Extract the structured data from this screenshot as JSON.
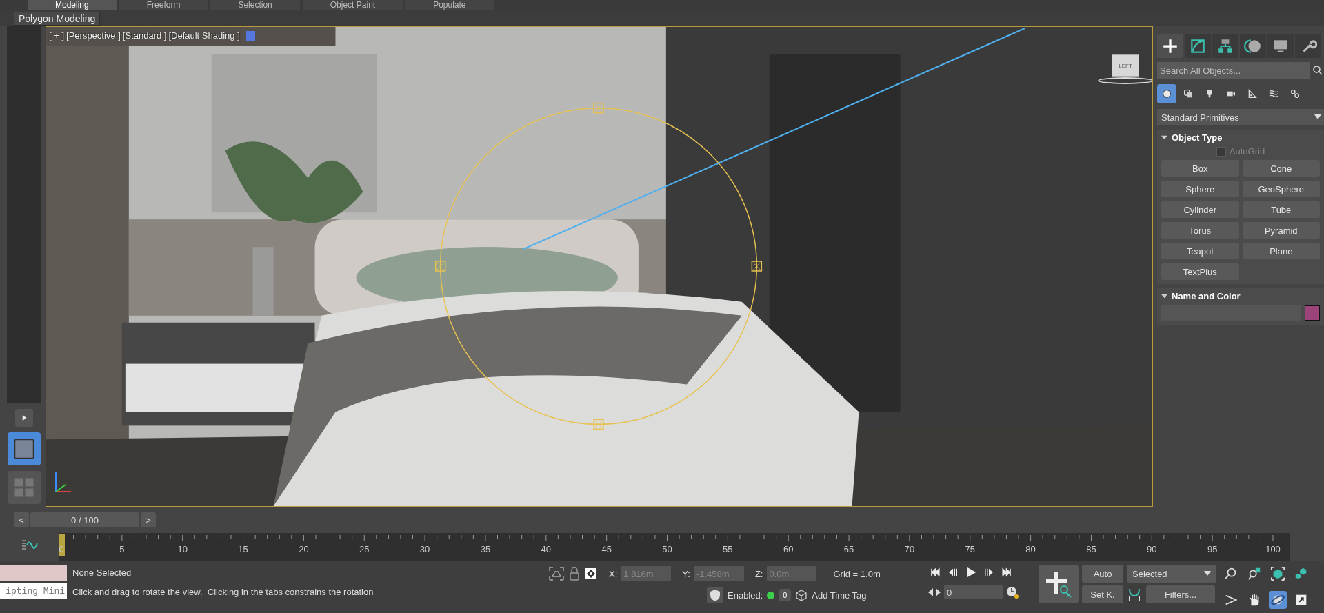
{
  "ribbon_tabs": [
    {
      "label": "Modeling",
      "selected": true
    },
    {
      "label": "Freeform",
      "selected": false
    },
    {
      "label": "Selection",
      "selected": false
    },
    {
      "label": "Object Paint",
      "selected": false
    },
    {
      "label": "Populate",
      "selected": false
    }
  ],
  "ribbon_panel": {
    "label": "Polygon Modeling"
  },
  "layouts": [
    {
      "kind": "single",
      "selected": true
    },
    {
      "kind": "quad",
      "selected": false
    }
  ],
  "viewport": {
    "labels": [
      "[ + ]",
      "[Perspective ]",
      "[Standard ]",
      "[Default Shading ]"
    ],
    "viewcube": "LEFT"
  },
  "command_panel": {
    "tabs": [
      {
        "kind": "create",
        "selected": true
      },
      {
        "kind": "modify",
        "selected": false
      },
      {
        "kind": "hierarchy",
        "selected": false
      },
      {
        "kind": "motion",
        "selected": false
      },
      {
        "kind": "display",
        "selected": false
      },
      {
        "kind": "utilities",
        "selected": false
      }
    ],
    "search": {
      "placeholder": "Search All Objects..."
    },
    "categories": [
      {
        "kind": "geometry",
        "selected": true
      },
      {
        "kind": "shapes",
        "selected": false
      },
      {
        "kind": "lights",
        "selected": false
      },
      {
        "kind": "cameras",
        "selected": false
      },
      {
        "kind": "helpers",
        "selected": false
      },
      {
        "kind": "spacewarps",
        "selected": false
      },
      {
        "kind": "systems",
        "selected": false
      }
    ],
    "dropdown": "Standard Primitives",
    "rollouts": [
      {
        "kind": "object_type",
        "title": "Object Type",
        "expanded": true,
        "autogrid": {
          "label": "AutoGrid",
          "checked": false,
          "disabled": true
        },
        "buttons": [
          "Box",
          "Cone",
          "Sphere",
          "GeoSphere",
          "Cylinder",
          "Tube",
          "Torus",
          "Pyramid",
          "Teapot",
          "Plane",
          "TextPlus"
        ]
      },
      {
        "kind": "name_color",
        "title": "Name and Color",
        "expanded": true,
        "color": "#9c4479"
      }
    ]
  },
  "time_slider": {
    "prev": "<",
    "label": "0 / 100",
    "next": ">",
    "level": 0
  },
  "trackbar": {
    "labels": [
      "0",
      "5",
      "10",
      "15",
      "20",
      "25",
      "30",
      "35",
      "40",
      "45",
      "50",
      "55",
      "60",
      "65",
      "70",
      "75",
      "80",
      "85",
      "90",
      "95",
      "100"
    ]
  },
  "status": {
    "listener": "ipting Mini",
    "selection": "None Selected",
    "prompt": "Click and drag to rotate the view.  Clicking in the tabs constrains the rotation",
    "coords": [
      {
        "label": "X:",
        "value": "1.816m"
      },
      {
        "label": "Y:",
        "value": "-1.458m"
      },
      {
        "label": "Z:",
        "value": "0.0m"
      }
    ],
    "grid": "Grid = 1.0m",
    "tags": {
      "label": "Enabled:",
      "on": true,
      "count": "0",
      "add": "Add Time Tag"
    }
  },
  "playback": {
    "buttons": [
      {
        "kind": "start"
      },
      {
        "kind": "prev"
      },
      {
        "kind": "play"
      },
      {
        "kind": "next"
      },
      {
        "kind": "end"
      }
    ],
    "frame": "0"
  },
  "keys": {
    "auto": "Auto",
    "set": "Set K.",
    "selection_set": "Selected",
    "filters": "Filters..."
  },
  "navigation": [
    {
      "kind": "zoom",
      "selected": false
    },
    {
      "kind": "zoom_all",
      "selected": false
    },
    {
      "kind": "zoom_extents",
      "selected": false
    },
    {
      "kind": "zoom_extents_all",
      "selected": false
    },
    {
      "kind": "fov",
      "selected": false
    },
    {
      "kind": "pan",
      "selected": false
    },
    {
      "kind": "orbit",
      "selected": true
    },
    {
      "kind": "maximize",
      "selected": false
    }
  ]
}
